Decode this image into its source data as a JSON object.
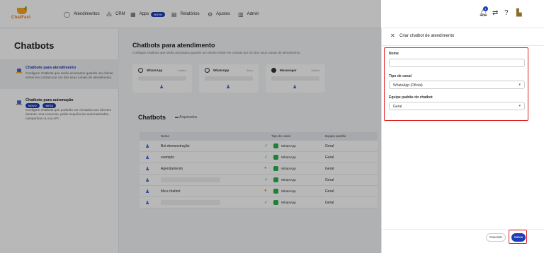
{
  "app": {
    "logo_text": "ChatFast"
  },
  "nav": {
    "atendimentos": "Atendimentos",
    "crm": "CRM",
    "apps": "Apps",
    "apps_badge": "NOVO",
    "relatorios": "Relatórios",
    "ajustes": "Ajustes",
    "admin": "Admin",
    "notif_count": "1"
  },
  "sidebar": {
    "title": "Chatbots",
    "items": [
      {
        "label": "Chatbots para atendimento",
        "desc": "Configure chatbots que serão acionados quando um cliente entrar em contato por um dos seus canais de atendimento."
      },
      {
        "label": "Chatbots para automação",
        "badge1": "NOVO",
        "badge2": "BETA",
        "desc": "Configure chatbots que poderão ser enviados aos clientes durante uma conversa, pelas sequências automatizadas, campanhas ou via API."
      }
    ]
  },
  "main": {
    "title": "Chatbots para atendimento",
    "subtitle": "Configure chatbots que serão acionados quando um cliente entrar em contato por um dos seus canais de atendimento.",
    "cards": [
      {
        "name": "WhatsApp",
        "status": "Inativo"
      },
      {
        "name": "WhatsApp",
        "status": "Ativo"
      },
      {
        "name": "Messenger",
        "status": "Definir"
      }
    ],
    "list_title": "Chatbots",
    "archived": "Arquivados",
    "columns": {
      "name": "Nome",
      "channel": "Tipo de canal",
      "team": "Equipe padrão"
    },
    "rows": [
      {
        "name": "Bot demonstração",
        "channel": "WhatsApp",
        "team": "Geral",
        "status": "check"
      },
      {
        "name": "exemplo",
        "channel": "WhatsApp",
        "team": "Geral",
        "status": "check"
      },
      {
        "name": "Agendamento",
        "channel": "WhatsApp",
        "team": "Geral",
        "status": "dot"
      },
      {
        "name": "",
        "channel": "WhatsApp",
        "team": "Geral",
        "status": "check"
      },
      {
        "name": "Meu chatbot",
        "channel": "WhatsApp",
        "team": "Geral",
        "status": "dot"
      },
      {
        "name": "",
        "channel": "WhatsApp",
        "team": "Geral",
        "status": "check"
      }
    ]
  },
  "drawer": {
    "title": "Criar chatbot de atendimento",
    "name_label": "Nome",
    "name_value": "",
    "channel_label": "Tipo de canal",
    "channel_value": "WhatsApp (Oficial)",
    "team_label": "Equipe padrão do chatbot",
    "team_value": "Geral",
    "cancel": "Cancelar",
    "save": "Salvar"
  },
  "colors": {
    "brand": "#1d3db8",
    "highlight": "#e02020",
    "whatsapp": "#2bb24c"
  }
}
